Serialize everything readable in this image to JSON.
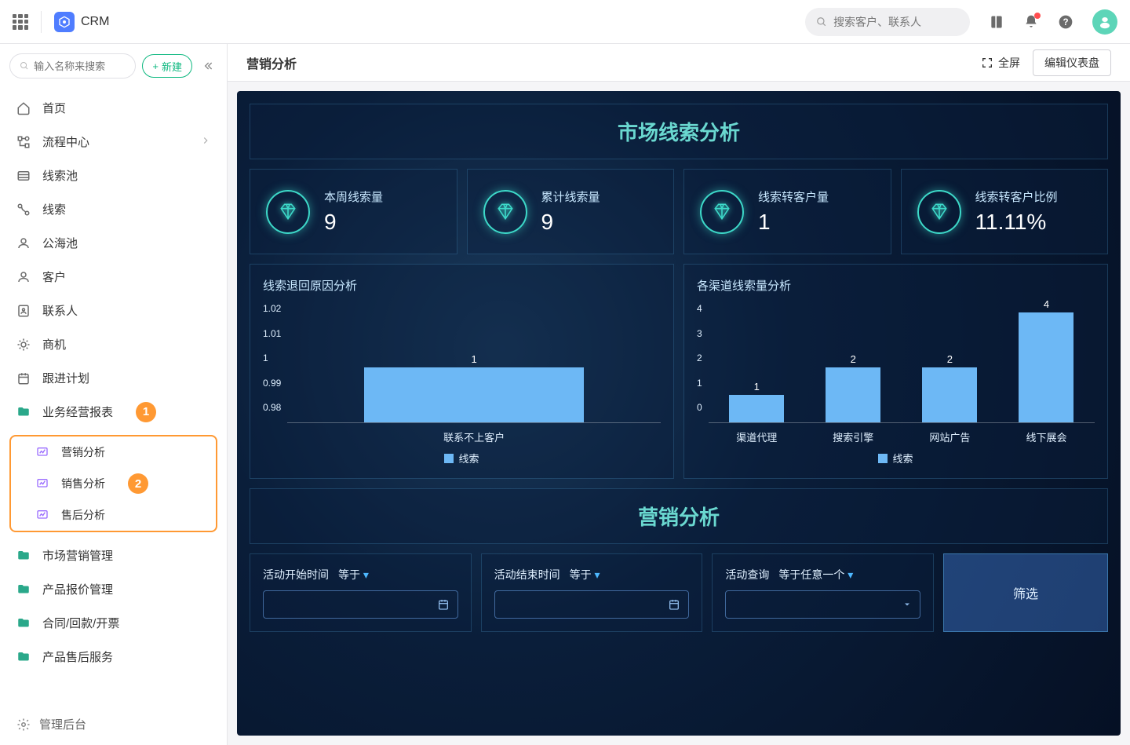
{
  "app": {
    "name": "CRM"
  },
  "header": {
    "search_placeholder": "搜索客户、联系人"
  },
  "sidebar": {
    "search_placeholder": "输入名称来搜索",
    "new_button": "新建",
    "items": [
      {
        "icon": "home",
        "label": "首页"
      },
      {
        "icon": "flow",
        "label": "流程中心",
        "chevron": true
      },
      {
        "icon": "leads-pool",
        "label": "线索池"
      },
      {
        "icon": "leads",
        "label": "线索"
      },
      {
        "icon": "sea",
        "label": "公海池"
      },
      {
        "icon": "customer",
        "label": "客户"
      },
      {
        "icon": "contact",
        "label": "联系人"
      },
      {
        "icon": "opportunity",
        "label": "商机"
      },
      {
        "icon": "follow",
        "label": "跟进计划"
      },
      {
        "icon": "folder",
        "label": "业务经营报表",
        "active": true,
        "badge": "1"
      },
      {
        "icon": "folder",
        "label": "市场营销管理"
      },
      {
        "icon": "folder",
        "label": "产品报价管理"
      },
      {
        "icon": "folder",
        "label": "合同/回款/开票"
      },
      {
        "icon": "folder",
        "label": "产品售后服务"
      }
    ],
    "sub_items": [
      {
        "label": "营销分析"
      },
      {
        "label": "销售分析"
      },
      {
        "label": "售后分析"
      }
    ],
    "sub_badge": "2",
    "admin": "管理后台"
  },
  "panel": {
    "title": "营销分析",
    "fullscreen": "全屏",
    "edit": "编辑仪表盘"
  },
  "dashboard": {
    "section1_title": "市场线索分析",
    "metrics": [
      {
        "label": "本周线索量",
        "value": "9"
      },
      {
        "label": "累计线索量",
        "value": "9"
      },
      {
        "label": "线索转客户量",
        "value": "1"
      },
      {
        "label": "线索转客户比例",
        "value": "11.11%"
      }
    ],
    "charts": [
      {
        "title": "线索退回原因分析",
        "legend": "线索"
      },
      {
        "title": "各渠道线索量分析",
        "legend": "线索"
      }
    ],
    "section2_title": "营销分析",
    "filters": [
      {
        "label": "活动开始时间",
        "op": "等于"
      },
      {
        "label": "活动结束时间",
        "op": "等于"
      },
      {
        "label": "活动查询",
        "op": "等于任意一个"
      }
    ],
    "filter_btn": "筛选"
  },
  "chart_data": [
    {
      "type": "bar",
      "title": "线索退回原因分析",
      "categories": [
        "联系不上客户"
      ],
      "values": [
        1
      ],
      "ylim": [
        0.98,
        1.02
      ],
      "yticks": [
        0.98,
        0.99,
        1,
        1.01,
        1.02
      ],
      "legend": "线索"
    },
    {
      "type": "bar",
      "title": "各渠道线索量分析",
      "categories": [
        "渠道代理",
        "搜索引擎",
        "网站广告",
        "线下展会"
      ],
      "values": [
        1,
        2,
        2,
        4
      ],
      "ylim": [
        0,
        4
      ],
      "yticks": [
        0,
        1,
        2,
        3,
        4
      ],
      "legend": "线索"
    }
  ]
}
